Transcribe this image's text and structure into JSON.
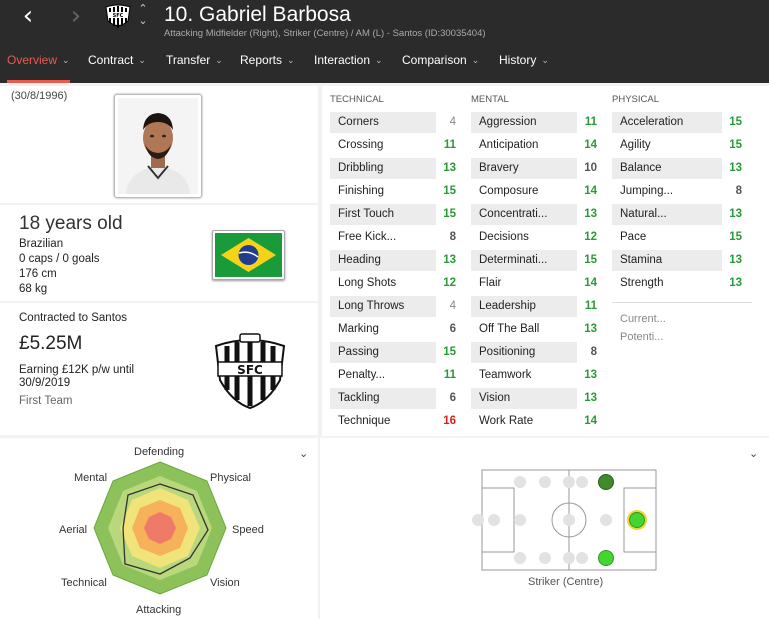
{
  "header": {
    "back_icon": "chevron-left-icon",
    "forward_icon": "chevron-right-icon",
    "player_name": "10. Gabriel Barbosa",
    "player_subtitle": "Attacking Midfielder (Right), Striker (Centre) / AM (L) - Santos (ID:30035404)"
  },
  "tabs": [
    {
      "label": "Overview",
      "active": true
    },
    {
      "label": "Contract"
    },
    {
      "label": "Transfer"
    },
    {
      "label": "Reports"
    },
    {
      "label": "Interaction"
    },
    {
      "label": "Comparison"
    },
    {
      "label": "History"
    }
  ],
  "profile": {
    "birth_date": "(30/8/1996)",
    "age": "18 years old",
    "nationality": "Brazilian",
    "caps": "0 caps / 0 goals",
    "height": "176 cm",
    "weight": "68 kg",
    "contracted": "Contracted to Santos",
    "value": "£5.25M",
    "earning": "Earning £12K p/w until 30/9/2019",
    "squad": "First Team"
  },
  "attributes": {
    "technical_label": "TECHNICAL",
    "mental_label": "MENTAL",
    "physical_label": "PHYSICAL",
    "technical": [
      {
        "name": "Corners",
        "value": "4"
      },
      {
        "name": "Crossing",
        "value": "11"
      },
      {
        "name": "Dribbling",
        "value": "13"
      },
      {
        "name": "Finishing",
        "value": "15"
      },
      {
        "name": "First Touch",
        "value": "15"
      },
      {
        "name": "Free Kick...",
        "value": "8"
      },
      {
        "name": "Heading",
        "value": "13"
      },
      {
        "name": "Long Shots",
        "value": "12"
      },
      {
        "name": "Long Throws",
        "value": "4"
      },
      {
        "name": "Marking",
        "value": "6"
      },
      {
        "name": "Passing",
        "value": "15"
      },
      {
        "name": "Penalty...",
        "value": "11"
      },
      {
        "name": "Tackling",
        "value": "6"
      },
      {
        "name": "Technique",
        "value": "16"
      }
    ],
    "mental": [
      {
        "name": "Aggression",
        "value": "11"
      },
      {
        "name": "Anticipation",
        "value": "14"
      },
      {
        "name": "Bravery",
        "value": "10"
      },
      {
        "name": "Composure",
        "value": "14"
      },
      {
        "name": "Concentrati...",
        "value": "13"
      },
      {
        "name": "Decisions",
        "value": "12"
      },
      {
        "name": "Determinati...",
        "value": "15"
      },
      {
        "name": "Flair",
        "value": "14"
      },
      {
        "name": "Leadership",
        "value": "11"
      },
      {
        "name": "Off The Ball",
        "value": "13"
      },
      {
        "name": "Positioning",
        "value": "8"
      },
      {
        "name": "Teamwork",
        "value": "13"
      },
      {
        "name": "Vision",
        "value": "13"
      },
      {
        "name": "Work Rate",
        "value": "14"
      }
    ],
    "physical": [
      {
        "name": "Acceleration",
        "value": "15"
      },
      {
        "name": "Agility",
        "value": "15"
      },
      {
        "name": "Balance",
        "value": "13"
      },
      {
        "name": "Jumping...",
        "value": "8"
      },
      {
        "name": "Natural...",
        "value": "13"
      },
      {
        "name": "Pace",
        "value": "15"
      },
      {
        "name": "Stamina",
        "value": "13"
      },
      {
        "name": "Strength",
        "value": "13"
      }
    ],
    "current_label": "Current...",
    "potential_label": "Potenti..."
  },
  "radar": {
    "labels": [
      "Defending",
      "Physical",
      "Speed",
      "Vision",
      "Attacking",
      "Technical",
      "Aerial",
      "Mental"
    ]
  },
  "pitch": {
    "position_label": "Striker (Centre)"
  },
  "colors": {
    "accent": "#e85b4e",
    "good": "#2a9a39",
    "excellent": "#d82020",
    "header_bg": "#2b2b2b"
  }
}
